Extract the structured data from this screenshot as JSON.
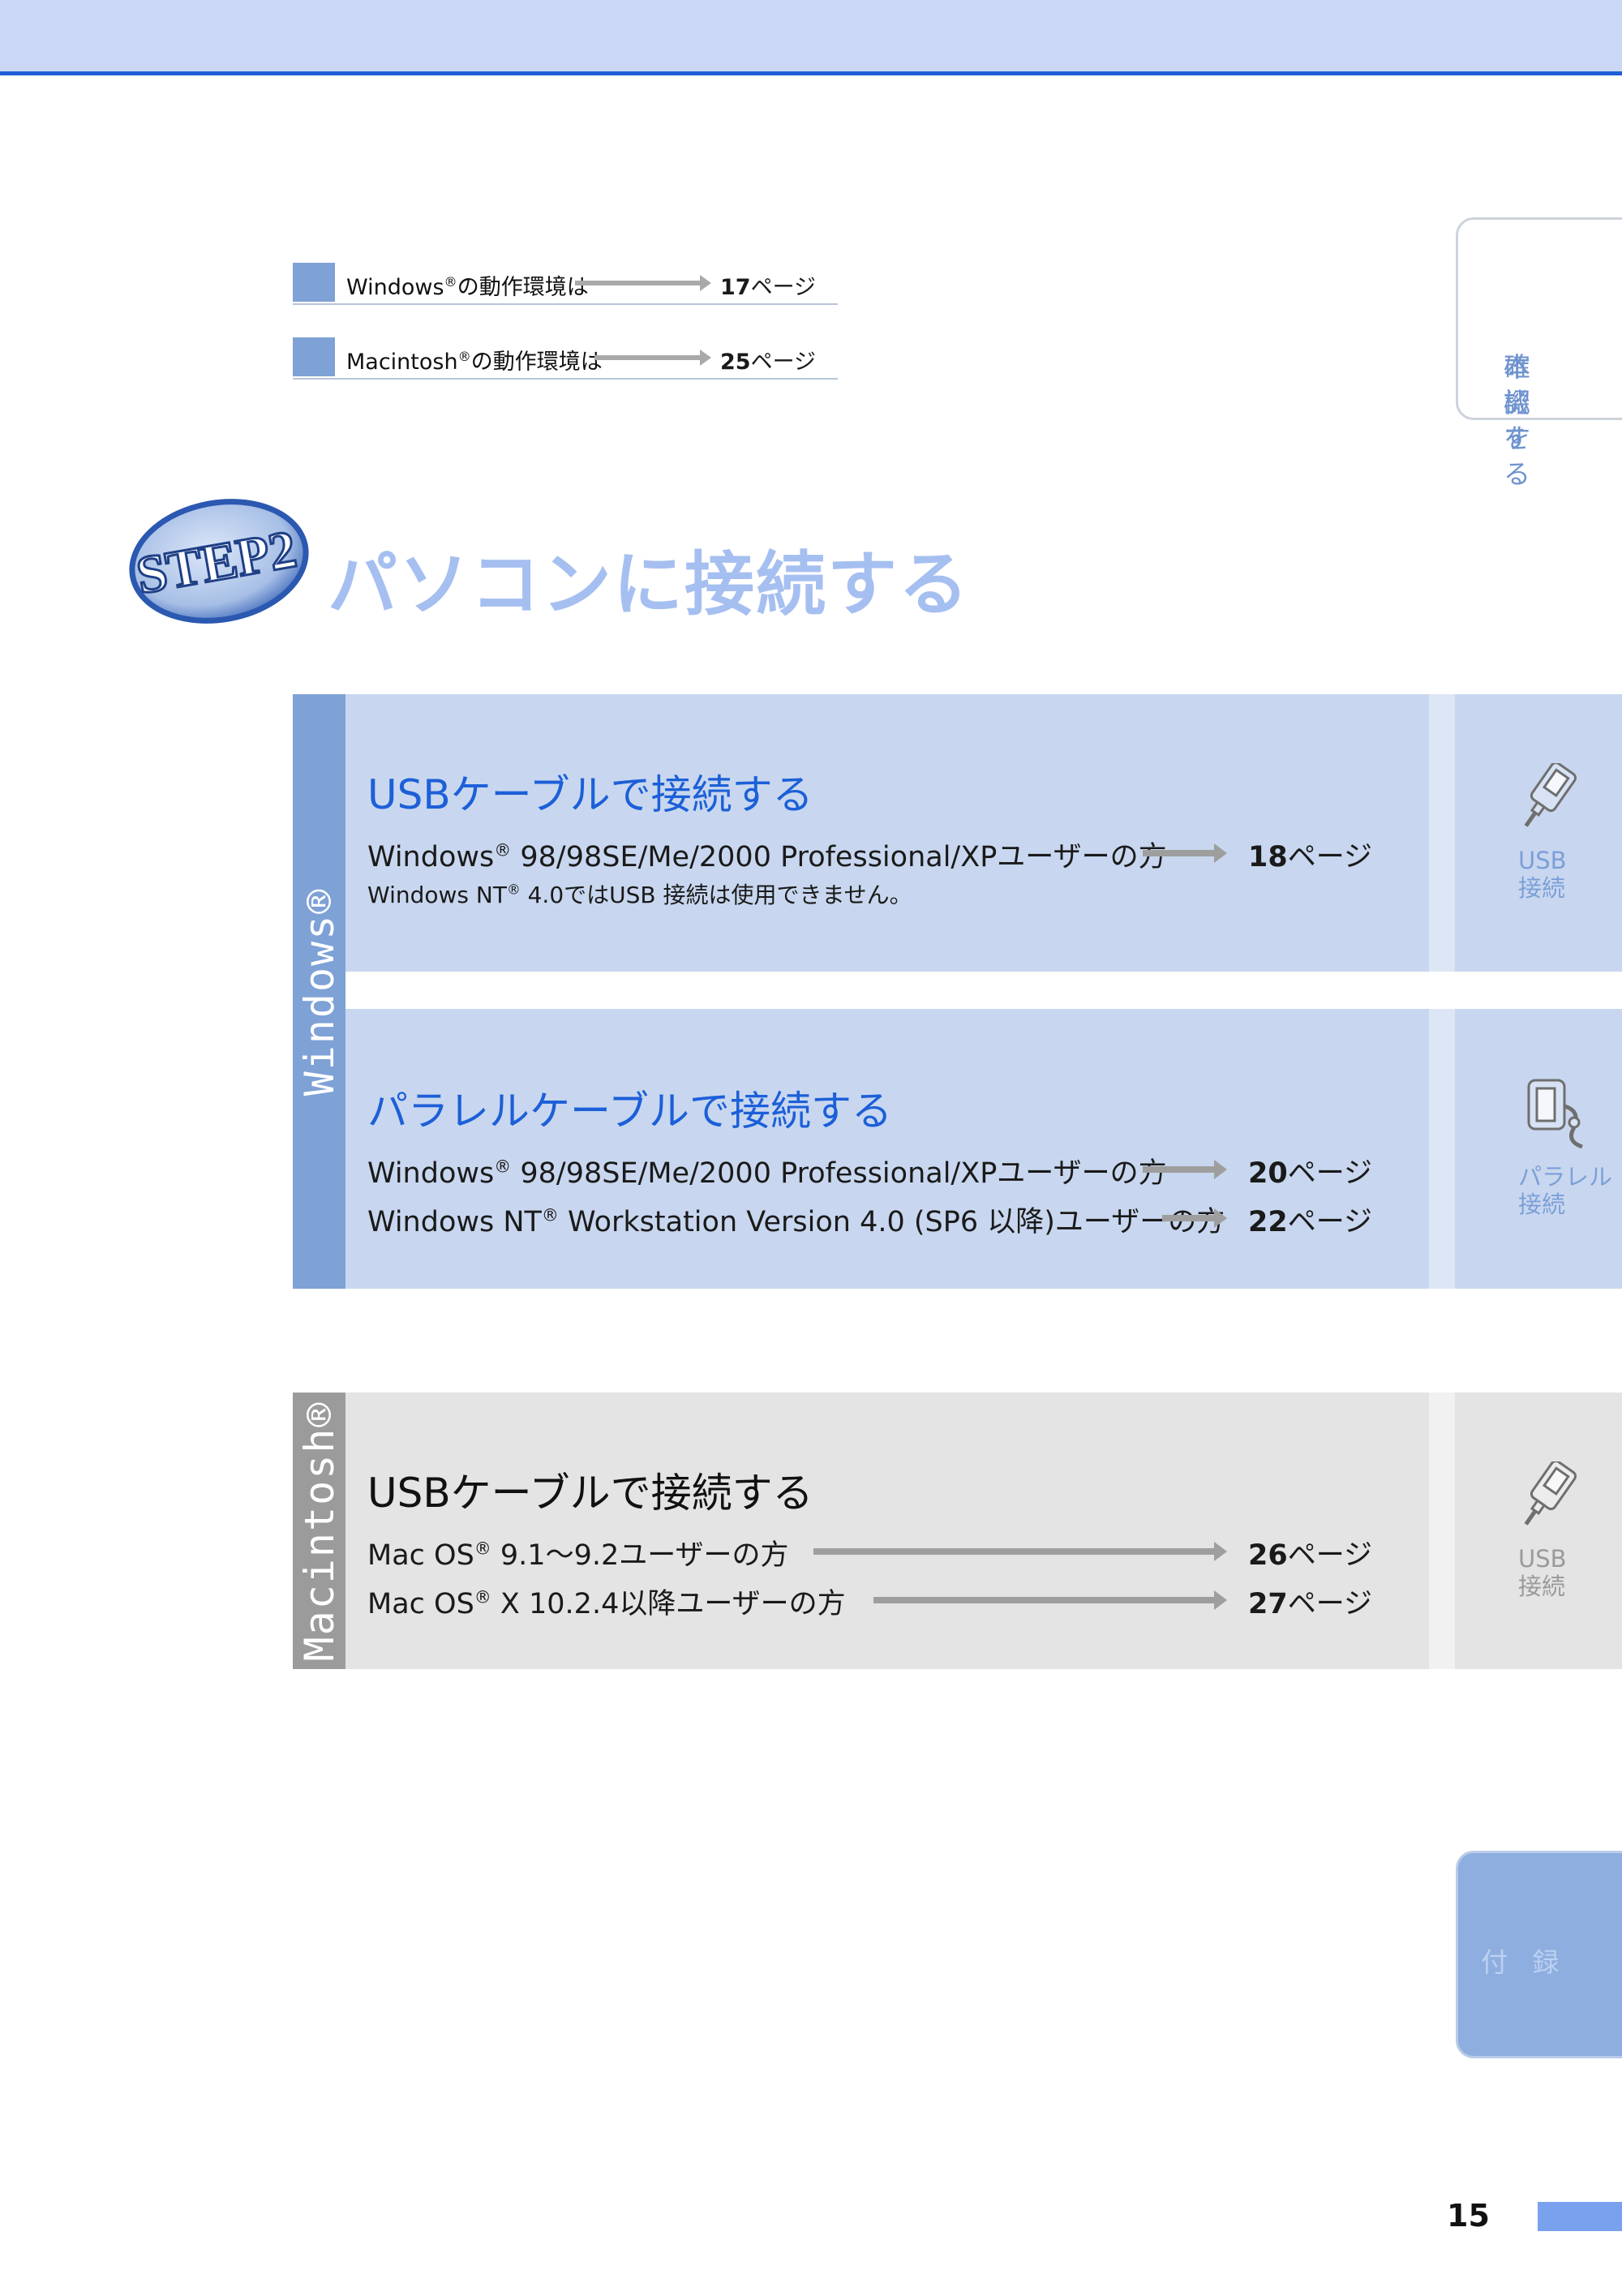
{
  "references": [
    {
      "label": "Windows",
      "reg": "®",
      "suffix": "の動作環境は",
      "page_num": "17",
      "page_unit": "ページ"
    },
    {
      "label": "Macintosh",
      "reg": "®",
      "suffix": "の動作環境は",
      "page_num": "25",
      "page_unit": "ページ"
    }
  ],
  "tabs": {
    "confirm": {
      "line1": "本機を",
      "line2": "確認する"
    },
    "appendix": "付 録"
  },
  "step": {
    "badge": "STEP2",
    "title": "パソコンに接続する"
  },
  "windows": {
    "band_label": "Windows®",
    "usb": {
      "title": "USBケーブルで接続する",
      "rows": [
        {
          "pre": "Windows",
          "reg": "®",
          "post": " 98/98SE/Me/2000 Professional/XPユーザーの方",
          "page_num": "18",
          "page_unit": "ページ"
        }
      ],
      "note_pre": "Windows NT",
      "note_reg": "®",
      "note_post": " 4.0ではUSB 接続は使用できません。",
      "side": {
        "line1": "USB",
        "line2": "接続",
        "icon": "usb-cable-icon"
      }
    },
    "parallel": {
      "title": "パラレルケーブルで接続する",
      "rows": [
        {
          "pre": "Windows",
          "reg": "®",
          "post": " 98/98SE/Me/2000 Professional/XPユーザーの方",
          "page_num": "20",
          "page_unit": "ページ"
        },
        {
          "pre": "Windows NT",
          "reg": "®",
          "post": " Workstation Version 4.0 (SP6 以降)ユーザーの方",
          "page_num": "22",
          "page_unit": "ページ"
        }
      ],
      "side": {
        "line1": "パラレル",
        "line2": "接続",
        "icon": "parallel-cable-icon"
      }
    }
  },
  "macintosh": {
    "band_label": "Macintosh®",
    "usb": {
      "title": "USBケーブルで接続する",
      "rows": [
        {
          "pre": "Mac OS",
          "reg": "®",
          "post": " 9.1～9.2ユーザーの方",
          "page_num": "26",
          "page_unit": "ページ"
        },
        {
          "pre": "Mac OS",
          "reg": "®",
          "post": " X 10.2.4以降ユーザーの方",
          "page_num": "27",
          "page_unit": "ページ"
        }
      ],
      "side": {
        "line1": "USB",
        "line2": "接続",
        "icon": "usb-cable-icon"
      }
    }
  },
  "page_number": "15",
  "colors": {
    "header": "#cad8f6",
    "header_rule": "#1f5fd6",
    "windows_band": "#7ea1d6",
    "macintosh_band": "#9b9b9b",
    "windows_panel": "#c8d7ef",
    "macintosh_panel": "#e4e4e4",
    "title_blue": "#1c5fd8"
  }
}
